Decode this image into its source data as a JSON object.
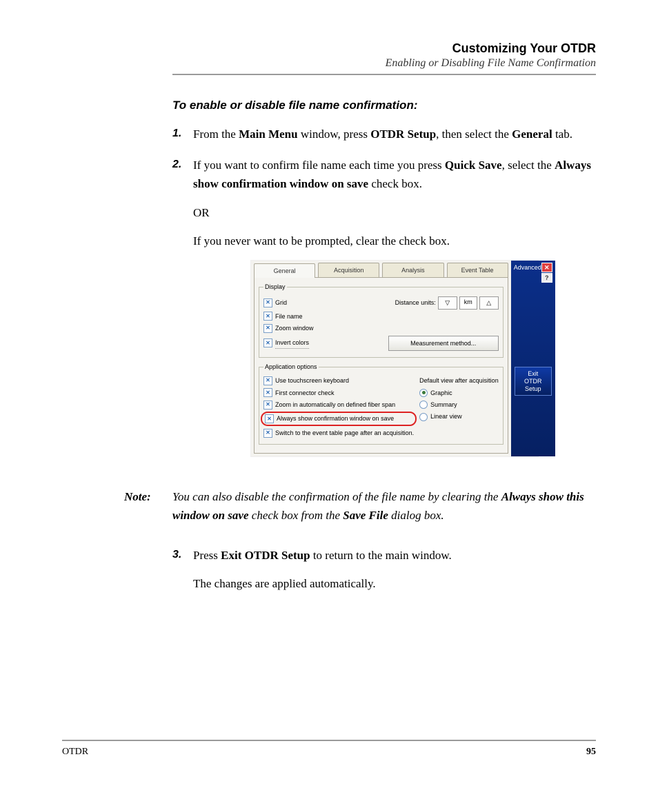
{
  "header": {
    "title": "Customizing Your OTDR",
    "subtitle": "Enabling or Disabling File Name Confirmation"
  },
  "section_title": "To enable or disable file name confirmation:",
  "steps": {
    "s1": {
      "num": "1.",
      "t1": "From the ",
      "b1": "Main Menu",
      "t2": " window, press ",
      "b2": "OTDR Setup",
      "t3": ", then select the ",
      "b3": "General",
      "t4": " tab."
    },
    "s2": {
      "num": "2.",
      "t1": "If you want to confirm file name each time you press ",
      "b1": "Quick Save",
      "t2": ", select the ",
      "b2": "Always show confirmation window on save",
      "t3": " check box.",
      "or": "OR",
      "p2": "If you never want to be prompted, clear the check box."
    },
    "s3": {
      "num": "3.",
      "t1": "Press ",
      "b1": "Exit OTDR Setup",
      "t2": " to return to the main window.",
      "p2": "The changes are applied automatically."
    }
  },
  "note": {
    "label": "Note:",
    "t1": "You can also disable the confirmation of the file name by clearing the ",
    "b1": "Always show this window on save",
    "t2": " check box from the ",
    "b2": "Save File",
    "t3": " dialog box."
  },
  "fig": {
    "tabs": {
      "general": "General",
      "acquisition": "Acquisition",
      "analysis": "Analysis",
      "event_table": "Event Table"
    },
    "display_legend": "Display",
    "appopt_legend": "Application options",
    "chk_grid": "Grid",
    "chk_filename": "File name",
    "chk_zoomwin": "Zoom window",
    "chk_invert": "Invert colors",
    "distance_units_label": "Distance units:",
    "unit": "km",
    "arrow_down": "▽",
    "arrow_up": "△",
    "mm_btn": "Measurement method...",
    "chk_touchkey": "Use touchscreen keyboard",
    "chk_firstconn": "First connector check",
    "chk_autozoom": "Zoom in automatically on defined fiber span",
    "chk_alwaysshow": "Always show confirmation window on save",
    "chk_switcht": "Switch to the event table page after an acquisition.",
    "defview_label": "Default view after acquisition",
    "radio_graphic": "Graphic",
    "radio_summary": "Summary",
    "radio_linear": "Linear view",
    "side_advanced": "Advanced",
    "side_close": "✕",
    "side_help": "?",
    "side_exit_l1": "Exit",
    "side_exit_l2": "OTDR Setup"
  },
  "footer": {
    "left": "OTDR",
    "page": "95"
  }
}
